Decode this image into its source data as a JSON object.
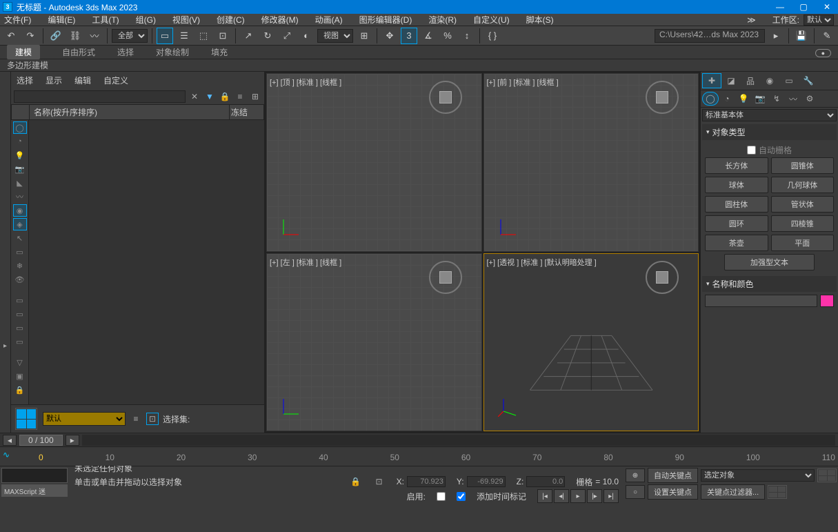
{
  "titlebar": {
    "title": "无标题 - Autodesk 3ds Max 2023",
    "app_icon": "3"
  },
  "menubar": {
    "items": [
      "文件(F)",
      "编辑(E)",
      "工具(T)",
      "组(G)",
      "视图(V)",
      "创建(C)",
      "修改器(M)",
      "动画(A)",
      "图形编辑器(D)",
      "渲染(R)",
      "自定义(U)",
      "脚本(S)"
    ],
    "workspace_label": "工作区:",
    "workspace_value": "默认"
  },
  "main_toolbar": {
    "scope": "全部",
    "viewmode": "视图",
    "path": "C:\\Users\\42…ds Max 2023"
  },
  "ribbon": {
    "tabs": [
      "建模",
      "自由形式",
      "选择",
      "对象绘制",
      "填充"
    ],
    "content": "多边形建模"
  },
  "scene_explorer": {
    "menu": [
      "选择",
      "显示",
      "编辑",
      "自定义"
    ],
    "header_name": "名称(按升序排序)",
    "header_freeze": "冻结",
    "footer_set": "默认",
    "footer_select_label": "选择集:"
  },
  "viewports": {
    "top": "[+] [顶 ] [标准 ] [线框 ]",
    "front": "[+] [前 ] [标准 ] [线框 ]",
    "left": "[+] [左 ] [标准 ] [线框 ]",
    "persp": "[+]  [透视 ]  [标准 ]  [默认明暗处理 ]"
  },
  "command_panel": {
    "category": "标准基本体",
    "rollout_object_type": "对象类型",
    "auto_grid": "自动栅格",
    "buttons": [
      "长方体",
      "圆锥体",
      "球体",
      "几何球体",
      "圆柱体",
      "管状体",
      "圆环",
      "四棱锥",
      "茶壶",
      "平面",
      "加强型文本"
    ],
    "rollout_name_color": "名称和颜色"
  },
  "time_slider": {
    "frame": "0  /  100"
  },
  "timeline": {
    "ticks": [
      "0",
      "10",
      "20",
      "30",
      "40",
      "50",
      "60",
      "70",
      "80",
      "90",
      "100",
      "110"
    ]
  },
  "status": {
    "prompt1": "未选定任何对象",
    "prompt2": "单击或单击并拖动以选择对象",
    "maxscript": "MAXScript 迷",
    "x_label": "X:",
    "x": "70.923",
    "y_label": "Y:",
    "y": "-69.929",
    "z_label": "Z:",
    "z": "0.0",
    "grid_label": "栅格",
    "grid": "= 10.0",
    "enable_label": "启用:",
    "add_time": "添加时间标记",
    "auto_key": "自动关键点",
    "selected": "选定对象",
    "set_key": "设置关键点",
    "key_filter": "关键点过滤器..."
  }
}
